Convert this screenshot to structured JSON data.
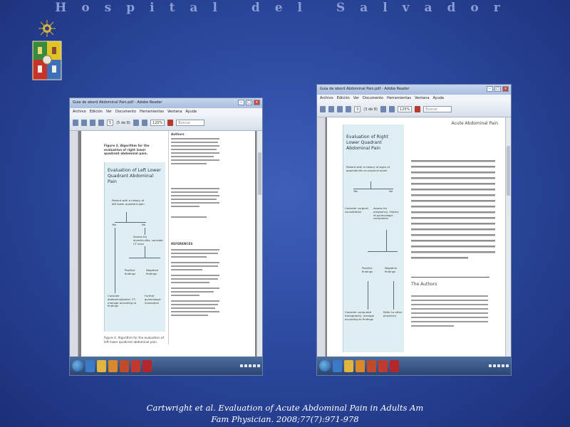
{
  "slide": {
    "header_title": "Hospital del Salvador",
    "caption_line1": "Cartwright  et al. Evaluation of Acute Abdominal Pain in Adults Am",
    "caption_line2": "Fam Physician. 2008;77(7):971-978"
  },
  "left_window": {
    "title": "Guia de abord Abdominal Pain.pdf - Adobe Reader",
    "menu": [
      "Archivo",
      "Edición",
      "Ver",
      "Documento",
      "Herramientas",
      "Ventana",
      "Ayuda"
    ],
    "page_number": "5",
    "page_total": "(5 de 8)",
    "zoom": "120%",
    "search_placeholder": "Buscar",
    "figure_caption_top": "Figure 3. Algorithm for the evaluation of right lower quadrant abdominal pain.",
    "figure_title": "Evaluation of Left Lower Quadrant Abdominal Pain",
    "nodes": {
      "history": "Patient with a history of left lower quadrant pain",
      "yes": "Yes",
      "no": "No",
      "eval": "Assess for diverticulitis; consider CT scan",
      "positive": "Positive findings",
      "negative": "Negative findings",
      "consider_ct": "Consider abdominal/pelvic CT; manage according to findings",
      "further": "Further gynecologic evaluation"
    },
    "figure_caption_bottom": "Figure 4. Algorithm for the evaluation of left lower quadrant abdominal pain.",
    "right_col_heading": "Authors",
    "references_heading": "REFERENCES"
  },
  "right_window": {
    "title": "Guia de abord Abdominal Pain.pdf - Adobe Reader",
    "menu": [
      "Archivo",
      "Edición",
      "Ver",
      "Documento",
      "Herramientas",
      "Ventana",
      "Ayuda"
    ],
    "page_number": "3",
    "page_total": "(3 de 8)",
    "zoom": "125%",
    "search_placeholder": "Buscar",
    "running_head": "Acute Abdominal Pain",
    "figure_title": "Evaluation of Right Lower Quadrant Abdominal Pain",
    "nodes": {
      "history": "Patient with a history of signs of appendicitis on physical exam",
      "yes": "Yes",
      "no": "No",
      "consider_surgery": "Consider surgical consultation",
      "assess": "Assess for pregnancy, history of gynecologic complaints",
      "positive": "Positive findings",
      "negative": "Negative findings",
      "consider_ct": "Consider computed tomography, manage according to findings",
      "refer": "Refer to other physician"
    },
    "authors_heading": "The Authors"
  },
  "colors": {
    "background": "#2d4aa0",
    "figure_fill": "#dfeef2",
    "taskbar": "#2b4574"
  }
}
